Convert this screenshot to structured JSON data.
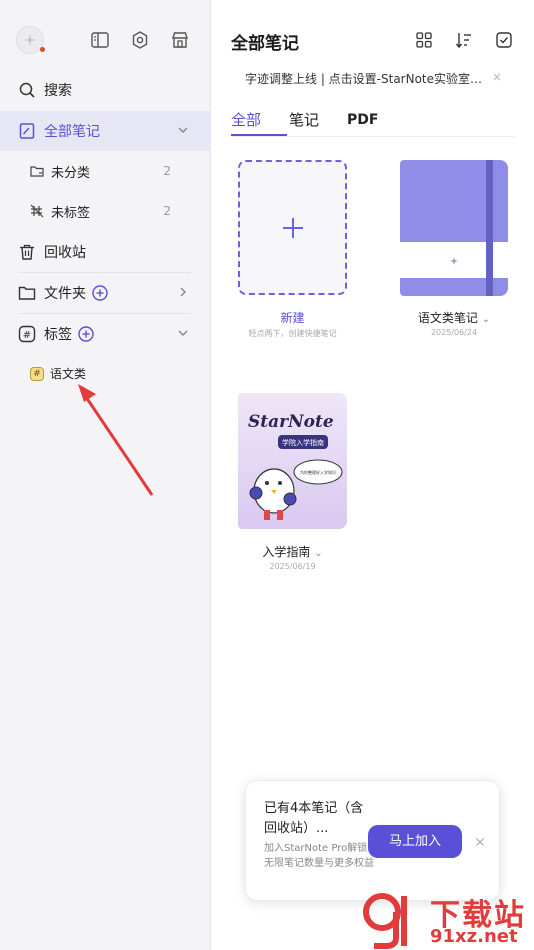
{
  "sidebar": {
    "search_label": "搜索",
    "all_notes_label": "全部笔记",
    "uncategorized_label": "未分类",
    "uncategorized_count": "2",
    "untagged_label": "未标签",
    "untagged_count": "2",
    "recycle_label": "回收站",
    "folders_label": "文件夹",
    "tags_label": "标签",
    "tag_items": [
      "语文类"
    ]
  },
  "header": {
    "title": "全部笔记",
    "icons": [
      "grid-view-icon",
      "sort-icon",
      "select-icon"
    ]
  },
  "banner": {
    "text": "字迹调整上线 | 点击设置-StarNote实验室开..."
  },
  "tabs": [
    "全部",
    "笔记",
    "PDF"
  ],
  "active_tab": "全部",
  "cards": {
    "new": {
      "label": "新建",
      "hint": "轻点两下，创建快捷笔记"
    },
    "notebook1": {
      "label": "语文类笔记",
      "date": "2025/06/24"
    },
    "notebook2": {
      "label": "入学指南",
      "date": "2025/06/19",
      "cover_title": "StarNote",
      "cover_subtitle": "学院入学指南",
      "cover_bubble": "为你整理好入学知识"
    }
  },
  "promo": {
    "title": "已有4本笔记（含回收站）...",
    "desc": "加入StarNote Pro解锁无限笔记数量与更多权益",
    "button": "马上加入"
  },
  "watermark": {
    "text": "下载站",
    "url": "91xz.net"
  },
  "colors": {
    "accent": "#5a50d8",
    "notebook": "#8f8de8",
    "badge": "#f6dd8a",
    "annotation": "#e13b3b"
  }
}
